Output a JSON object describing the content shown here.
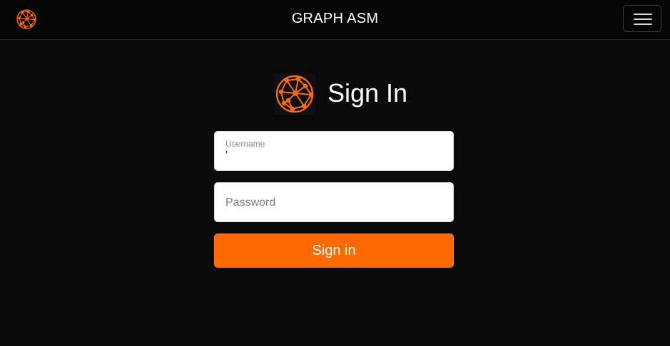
{
  "navbar": {
    "title": "GRAPH ASM",
    "logo_icon": "network-globe-icon",
    "menu_icon": "hamburger-menu-icon"
  },
  "signin": {
    "heading": "Sign In",
    "logo_icon": "network-globe-icon",
    "username": {
      "label": "Username",
      "value": "'"
    },
    "password": {
      "placeholder": "Password",
      "value": ""
    },
    "submit_label": "Sign in"
  },
  "colors": {
    "accent": "#ff6a00",
    "background": "#0a0a0a",
    "text": "#ffffff"
  }
}
